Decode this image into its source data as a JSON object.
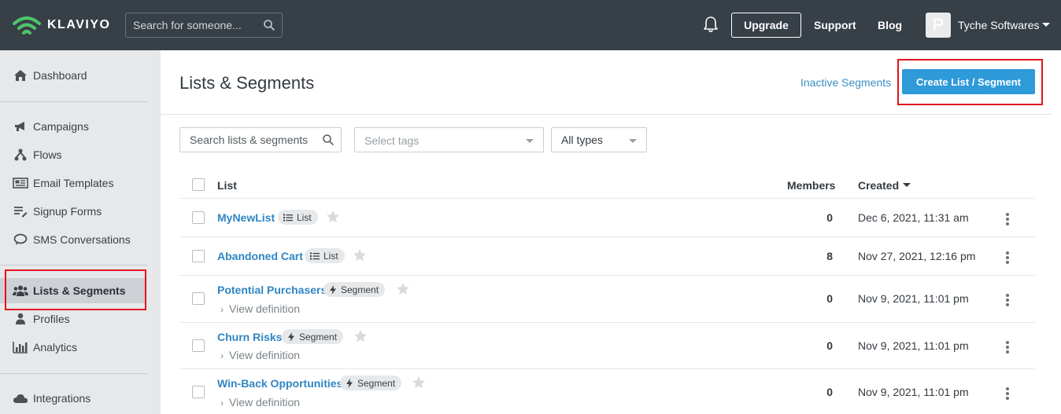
{
  "brand": {
    "name": "KLAVIYO",
    "accent": "#2e9ad9",
    "logo_green": "#4ec46b"
  },
  "topbar": {
    "search_placeholder": "Search for someone...",
    "upgrade_label": "Upgrade",
    "support_label": "Support",
    "blog_label": "Blog",
    "avatar_initial": "P",
    "account_name": "Tyche Softwares"
  },
  "sidebar": {
    "items": [
      {
        "label": "Dashboard",
        "icon": "home-icon"
      },
      {
        "label": "Campaigns",
        "icon": "megaphone-icon"
      },
      {
        "label": "Flows",
        "icon": "flow-icon"
      },
      {
        "label": "Email Templates",
        "icon": "newspaper-icon"
      },
      {
        "label": "Signup Forms",
        "icon": "form-list-icon"
      },
      {
        "label": "SMS Conversations",
        "icon": "chat-icon"
      },
      {
        "label": "Lists & Segments",
        "icon": "users-icon",
        "active": true
      },
      {
        "label": "Profiles",
        "icon": "user-icon"
      },
      {
        "label": "Analytics",
        "icon": "bar-chart-icon"
      },
      {
        "label": "Integrations",
        "icon": "cloud-icon"
      }
    ]
  },
  "main": {
    "title": "Lists & Segments",
    "inactive_link": "Inactive Segments",
    "create_button": "Create List / Segment",
    "filters": {
      "search_placeholder": "Search lists & segments",
      "tags_placeholder": "Select tags",
      "type_value": "All types"
    },
    "columns": {
      "list": "List",
      "members": "Members",
      "created": "Created"
    },
    "rows": [
      {
        "name": "MyNewList",
        "type": "List",
        "members": "0",
        "created": "Dec 6, 2021, 11:31 am",
        "view_definition": ""
      },
      {
        "name": "Abandoned Cart",
        "type": "List",
        "members": "8",
        "created": "Nov 27, 2021, 12:16 pm",
        "view_definition": ""
      },
      {
        "name": "Potential Purchasers",
        "type": "Segment",
        "members": "0",
        "created": "Nov 9, 2021, 11:01 pm",
        "view_definition": "View definition"
      },
      {
        "name": "Churn Risks",
        "type": "Segment",
        "members": "0",
        "created": "Nov 9, 2021, 11:01 pm",
        "view_definition": "View definition"
      },
      {
        "name": "Win-Back Opportunities",
        "type": "Segment",
        "members": "0",
        "created": "Nov 9, 2021, 11:01 pm",
        "view_definition": "View definition"
      }
    ]
  }
}
